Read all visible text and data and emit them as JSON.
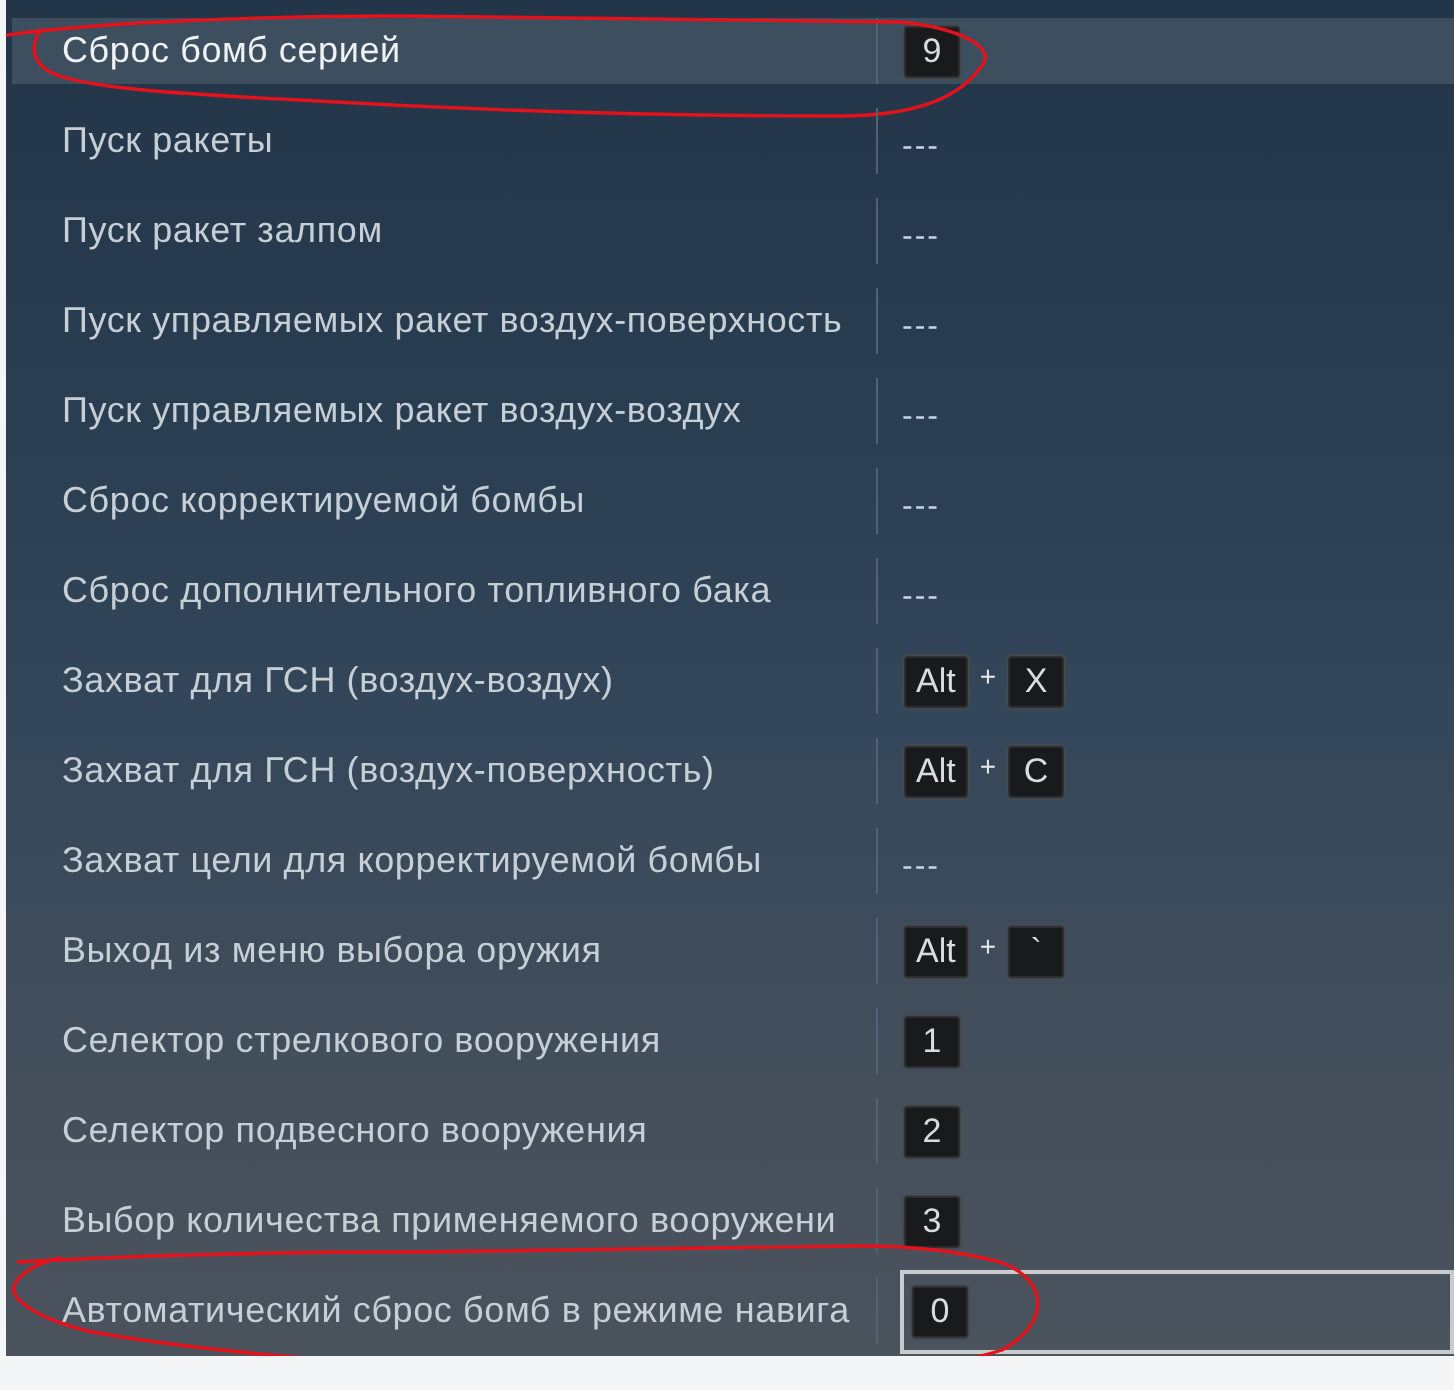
{
  "controls": {
    "rows": [
      {
        "action": "Сброс бомб серией",
        "selected": true,
        "circled": true,
        "binding_focused": false,
        "binding": [
          {
            "kind": "key",
            "text": "9"
          }
        ]
      },
      {
        "action": "Пуск ракеты",
        "selected": false,
        "circled": false,
        "binding_focused": false,
        "binding": [
          {
            "kind": "none",
            "text": "---"
          }
        ]
      },
      {
        "action": "Пуск ракет залпом",
        "selected": false,
        "circled": false,
        "binding_focused": false,
        "binding": [
          {
            "kind": "none",
            "text": "---"
          }
        ]
      },
      {
        "action": "Пуск управляемых ракет воздух-поверхность",
        "selected": false,
        "circled": false,
        "binding_focused": false,
        "binding": [
          {
            "kind": "none",
            "text": "---"
          }
        ]
      },
      {
        "action": "Пуск управляемых ракет воздух-воздух",
        "selected": false,
        "circled": false,
        "binding_focused": false,
        "binding": [
          {
            "kind": "none",
            "text": "---"
          }
        ]
      },
      {
        "action": "Сброс корректируемой бомбы",
        "selected": false,
        "circled": false,
        "binding_focused": false,
        "binding": [
          {
            "kind": "none",
            "text": "---"
          }
        ]
      },
      {
        "action": "Сброс дополнительного топливного бака",
        "selected": false,
        "circled": false,
        "binding_focused": false,
        "binding": [
          {
            "kind": "none",
            "text": "---"
          }
        ]
      },
      {
        "action": "Захват для ГСН (воздух-воздух)",
        "selected": false,
        "circled": false,
        "binding_focused": false,
        "binding": [
          {
            "kind": "key",
            "text": "Alt"
          },
          {
            "kind": "plus",
            "text": "+"
          },
          {
            "kind": "key",
            "text": "X"
          }
        ]
      },
      {
        "action": "Захват для ГСН (воздух-поверхность)",
        "selected": false,
        "circled": false,
        "binding_focused": false,
        "binding": [
          {
            "kind": "key",
            "text": "Alt"
          },
          {
            "kind": "plus",
            "text": "+"
          },
          {
            "kind": "key",
            "text": "C"
          }
        ]
      },
      {
        "action": "Захват цели для корректируемой бомбы",
        "selected": false,
        "circled": false,
        "binding_focused": false,
        "binding": [
          {
            "kind": "none",
            "text": "---"
          }
        ]
      },
      {
        "action": "Выход из меню выбора оружия",
        "selected": false,
        "circled": false,
        "binding_focused": false,
        "binding": [
          {
            "kind": "key",
            "text": "Alt"
          },
          {
            "kind": "plus",
            "text": "+"
          },
          {
            "kind": "key",
            "text": "`"
          }
        ]
      },
      {
        "action": "Селектор стрелкового вооружения",
        "selected": false,
        "circled": false,
        "binding_focused": false,
        "binding": [
          {
            "kind": "key",
            "text": "1"
          }
        ]
      },
      {
        "action": "Селектор подвесного вооружения",
        "selected": false,
        "circled": false,
        "binding_focused": false,
        "binding": [
          {
            "kind": "key",
            "text": "2"
          }
        ]
      },
      {
        "action": "Выбор количества применяемого вооружени",
        "selected": false,
        "circled": false,
        "binding_focused": false,
        "binding": [
          {
            "kind": "key",
            "text": "3"
          }
        ]
      },
      {
        "action": "Автоматический сброс бомб в режиме навига",
        "selected": false,
        "circled": true,
        "binding_focused": true,
        "binding": [
          {
            "kind": "key",
            "text": "0"
          }
        ]
      }
    ]
  }
}
